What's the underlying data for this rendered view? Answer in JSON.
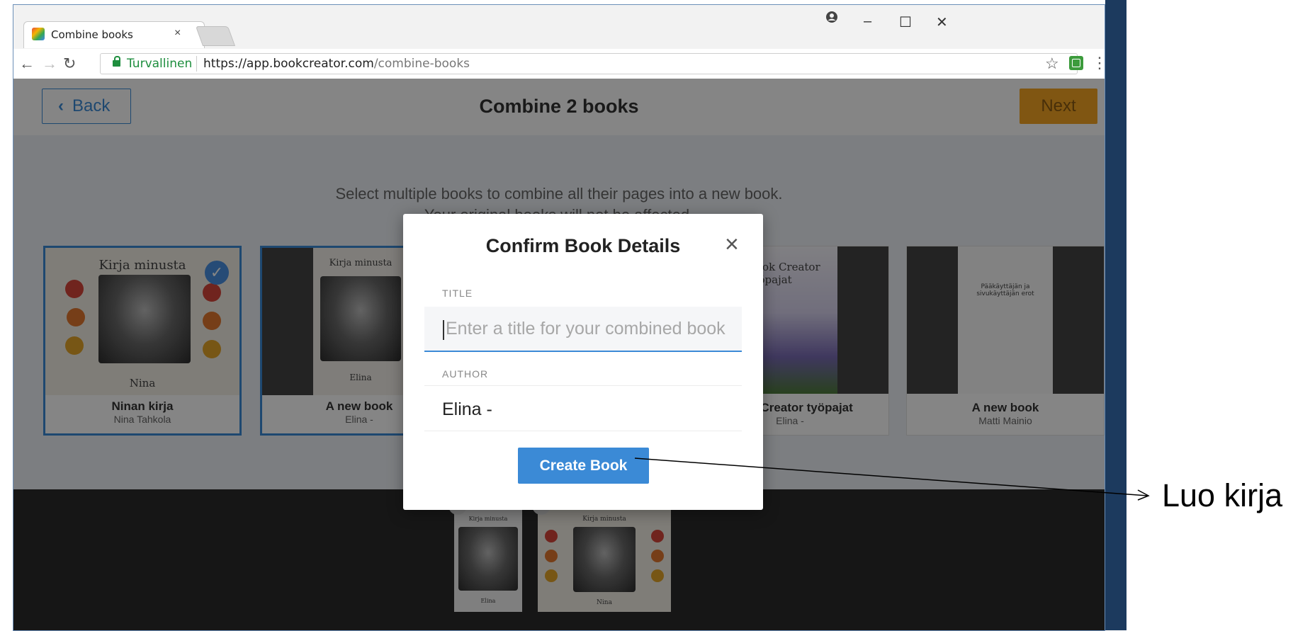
{
  "browser": {
    "tab_title": "Combine books",
    "tab_close": "×",
    "secure_label": "Turvallinen",
    "url_host": "https://app.bookcreator.com",
    "url_path": "/combine-books",
    "window_controls": {
      "minimize": "–",
      "maximize": "☐",
      "close": "✕"
    }
  },
  "header": {
    "back_label": "Back",
    "title": "Combine 2 books",
    "next_label": "Next"
  },
  "gallery": {
    "instruction_line1": "Select multiple books to combine all their pages into a new book.",
    "instruction_line2": "Your original books will not be affected.",
    "books": [
      {
        "cover_title": "Kirja minusta",
        "cover_author": "Nina",
        "name": "Ninan kirja",
        "author": "Nina Tahkola",
        "selected": true
      },
      {
        "cover_title": "Kirja minusta",
        "cover_author": "Elina",
        "name": "A new book",
        "author": "Elina -",
        "selected": true
      },
      {
        "cover_title": "Book Creator työpajat",
        "name": "Book Creator työpajat",
        "author": "Elina -",
        "selected": false
      },
      {
        "cover_title": "Pääkäyttäjän ja sivukäyttäjän erot",
        "name": "A new book",
        "author": "Matti Mainio",
        "selected": false
      }
    ]
  },
  "tray": {
    "items": [
      {
        "cover_title": "Kirja minusta",
        "cover_author": "Elina"
      },
      {
        "cover_title": "Kirja minusta",
        "cover_author": "Nina"
      }
    ]
  },
  "modal": {
    "title": "Confirm Book Details",
    "title_label": "TITLE",
    "title_placeholder": "Enter a title for your combined book",
    "author_label": "AUTHOR",
    "author_value": "Elina -",
    "create_label": "Create Book"
  },
  "annotation": {
    "text": "Luo kirja"
  },
  "colors": {
    "accent": "#3b8ad6",
    "next_button": "#f5a623",
    "secure_green": "#1e8e3e"
  },
  "icons": [
    "tab-favicon-icon",
    "close-icon",
    "back-arrow-icon",
    "forward-arrow-icon",
    "reload-icon",
    "lock-icon",
    "star-icon",
    "extension-icon",
    "menu-dots-icon",
    "chevron-left-icon",
    "checkmark-icon",
    "profile-icon"
  ]
}
